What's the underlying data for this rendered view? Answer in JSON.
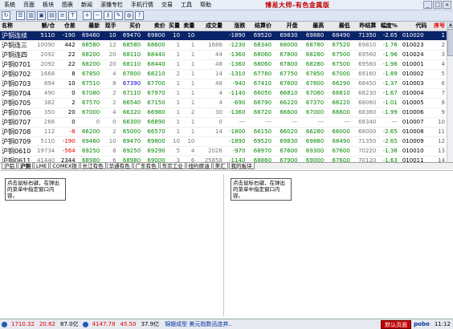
{
  "menubar": {
    "items": [
      "系统",
      "页面",
      "板块",
      "图表",
      "新闻",
      "滚播专栏",
      "手机行情",
      "交易",
      "工具",
      "帮助"
    ],
    "title": "博易大师-有色金属版"
  },
  "window_controls": {
    "min": "_",
    "max": "□",
    "close": "×"
  },
  "toolbar": {
    "icons": [
      "refresh-icon",
      "quote-list-icon",
      "chart-icon",
      "window-icon",
      "indicator-icon",
      "news-icon",
      "text-icon",
      "zoom-in-icon",
      "zoom-out-icon",
      "key-icon",
      "tools-icon",
      "globe-icon",
      "info-icon"
    ]
  },
  "quote_table": {
    "columns": [
      "名称",
      "额/仓",
      "仓差",
      "最新",
      "现手",
      "买价",
      "卖价",
      "买量",
      "卖量",
      "成交量",
      "涨跌",
      "结算价",
      "开盘",
      "最高",
      "最低",
      "昨结算",
      "幅度%",
      "代码",
      "序号"
    ],
    "rows": [
      {
        "name": "沪铜连续",
        "vol_hold": "5110",
        "hold_chg": "-190",
        "last": "69460",
        "cur_vol": "10",
        "bid": "69470",
        "ask": "69800",
        "bid_vol": "10",
        "ask_vol": "10",
        "volume": "",
        "change": "-1890",
        "settle": "69520",
        "open": "69830",
        "high": "69880",
        "low": "68490",
        "pre_settle": "71350",
        "pct": "-2.65",
        "code": "010020",
        "seq": "1",
        "selected": true
      },
      {
        "name": "沪铜连三",
        "vol_hold": "10090",
        "hold_chg": "442",
        "last": "68580",
        "cur_vol": "12",
        "bid": "68580",
        "ask": "68600",
        "bid_vol": "1",
        "ask_vol": "1",
        "volume": "1686",
        "change": "-1230",
        "settle": "68340",
        "open": "68000",
        "high": "68780",
        "low": "67520",
        "pre_settle": "69810",
        "pct": "-1.76",
        "code": "010023",
        "seq": "2"
      },
      {
        "name": "沪铜连四",
        "vol_hold": "2092",
        "hold_chg": "22",
        "last": "68200",
        "cur_vol": "20",
        "bid": "68110",
        "ask": "68440",
        "bid_vol": "1",
        "ask_vol": "1",
        "volume": "44",
        "change": "-1360",
        "settle": "68060",
        "open": "67800",
        "high": "68280",
        "low": "67500",
        "pre_settle": "69560",
        "pct": "-1.96",
        "code": "010024",
        "seq": "3"
      },
      {
        "name": "沪铜0701",
        "vol_hold": "2092",
        "hold_chg": "22",
        "last": "68200",
        "cur_vol": "20",
        "bid": "68110",
        "ask": "68440",
        "bid_vol": "1",
        "ask_vol": "1",
        "volume": "48",
        "change": "-1360",
        "settle": "68060",
        "open": "67800",
        "high": "68280",
        "low": "67500",
        "pre_settle": "69560",
        "pct": "-1.96",
        "code": "010001",
        "seq": "4"
      },
      {
        "name": "沪铜0702",
        "vol_hold": "1668",
        "hold_chg": "8",
        "last": "67850",
        "cur_vol": "4",
        "bid": "67800",
        "ask": "68210",
        "bid_vol": "2",
        "ask_vol": "1",
        "volume": "14",
        "change": "-1310",
        "settle": "67780",
        "open": "67750",
        "high": "67850",
        "low": "67000",
        "pre_settle": "69160",
        "pct": "-1.89",
        "code": "010002",
        "seq": "5"
      },
      {
        "name": "沪铜0703",
        "vol_hold": "894",
        "hold_chg": "10",
        "last": "67510",
        "cur_vol": "8",
        "bid": "67390",
        "ask": "67700",
        "bid_vol": "1",
        "ask_vol": "1",
        "volume": "48",
        "change": "-940",
        "settle": "67410",
        "open": "67600",
        "high": "67800",
        "low": "66290",
        "pre_settle": "68450",
        "pct": "-1.37",
        "code": "010003",
        "seq": "6"
      },
      {
        "name": "沪铜0704",
        "vol_hold": "490",
        "hold_chg": "0",
        "last": "67080",
        "cur_vol": "2",
        "bid": "67110",
        "ask": "67970",
        "bid_vol": "1",
        "ask_vol": "1",
        "volume": "4",
        "change": "-1140",
        "settle": "66050",
        "open": "66810",
        "high": "67080",
        "low": "66810",
        "pre_settle": "68230",
        "pct": "-1.67",
        "code": "010004",
        "seq": "7"
      },
      {
        "name": "沪铜0705",
        "vol_hold": "382",
        "hold_chg": "2",
        "last": "67570",
        "cur_vol": "2",
        "bid": "66540",
        "ask": "67150",
        "bid_vol": "1",
        "ask_vol": "1",
        "volume": "4",
        "change": "-690",
        "settle": "66790",
        "open": "66220",
        "high": "67370",
        "low": "66220",
        "pre_settle": "68060",
        "pct": "-1.01",
        "code": "010005",
        "seq": "8"
      },
      {
        "name": "沪铜0706",
        "vol_hold": "350",
        "hold_chg": "20",
        "last": "67000",
        "cur_vol": "4",
        "bid": "66320",
        "ask": "66980",
        "bid_vol": "1",
        "ask_vol": "2",
        "volume": "30",
        "change": "-1360",
        "settle": "66720",
        "open": "66600",
        "high": "67000",
        "low": "66600",
        "pre_settle": "68360",
        "pct": "-1.99",
        "code": "010006",
        "seq": "9"
      },
      {
        "name": "沪铜0707",
        "vol_hold": "266",
        "hold_chg": "0",
        "last": "0",
        "cur_vol": "0",
        "bid": "66300",
        "ask": "66890",
        "bid_vol": "1",
        "ask_vol": "1",
        "volume": "0",
        "change": "---",
        "settle": "---",
        "open": "---",
        "high": "---",
        "low": "---",
        "pre_settle": "68340",
        "pct": "---",
        "code": "010007",
        "seq": "10"
      },
      {
        "name": "沪铜0708",
        "vol_hold": "112",
        "hold_chg": "-8",
        "last": "66200",
        "cur_vol": "2",
        "bid": "65000",
        "ask": "66570",
        "bid_vol": "1",
        "ask_vol": "1",
        "volume": "14",
        "change": "-1800",
        "settle": "66150",
        "open": "66020",
        "high": "66280",
        "low": "66000",
        "pre_settle": "68000",
        "pct": "-2.65",
        "code": "010008",
        "seq": "11"
      },
      {
        "name": "沪铜0709",
        "vol_hold": "5110",
        "hold_chg": "-190",
        "last": "69460",
        "cur_vol": "10",
        "bid": "69470",
        "ask": "69800",
        "bid_vol": "10",
        "ask_vol": "10",
        "volume": "",
        "change": "-1890",
        "settle": "69520",
        "open": "69830",
        "high": "69880",
        "low": "68490",
        "pre_settle": "71350",
        "pct": "-2.65",
        "code": "010009",
        "seq": "12"
      },
      {
        "name": "沪铜0610",
        "vol_hold": "19734",
        "hold_chg": "-564",
        "last": "69250",
        "cur_vol": "8",
        "bid": "69250",
        "ask": "69290",
        "bid_vol": "5",
        "ask_vol": "4",
        "volume": "2026",
        "change": "-970",
        "settle": "68970",
        "open": "67600",
        "high": "69300",
        "low": "67600",
        "pre_settle": "70220",
        "pct": "-1.38",
        "code": "010010",
        "seq": "13"
      },
      {
        "name": "沪铜0611",
        "vol_hold": "41440",
        "hold_chg": "2344",
        "last": "68980",
        "cur_vol": "6",
        "bid": "68980",
        "ask": "69000",
        "bid_vol": "3",
        "ask_vol": "6",
        "volume": "25858",
        "change": "-1140",
        "settle": "68860",
        "open": "67900",
        "high": "69000",
        "low": "67600",
        "pre_settle": "70120",
        "pct": "-1.63",
        "code": "010011",
        "seq": "14"
      }
    ]
  },
  "market_tabs": {
    "items": [
      "沪铝",
      "沪铜",
      "LME",
      "COMEX铜",
      "长江有色",
      "华通有色",
      "广东有色",
      "东京工业",
      "纽约原油",
      "美汇",
      "我的板块"
    ],
    "active_index": 1
  },
  "panes": {
    "hint_text": "点击鼠标右键，在弹出的菜单中指定窗口内容。"
  },
  "statusbar": {
    "index1_value": "1710.32",
    "index1_change": "20.62",
    "index1_amount": "87.0亿",
    "index2_value": "4147.78",
    "index2_change": "45.50",
    "index2_amount": "37.9亿",
    "news": "锦银成型 美元指数迅连弃..",
    "login": "默认页面",
    "brand": "pobo",
    "time": "11:12"
  }
}
